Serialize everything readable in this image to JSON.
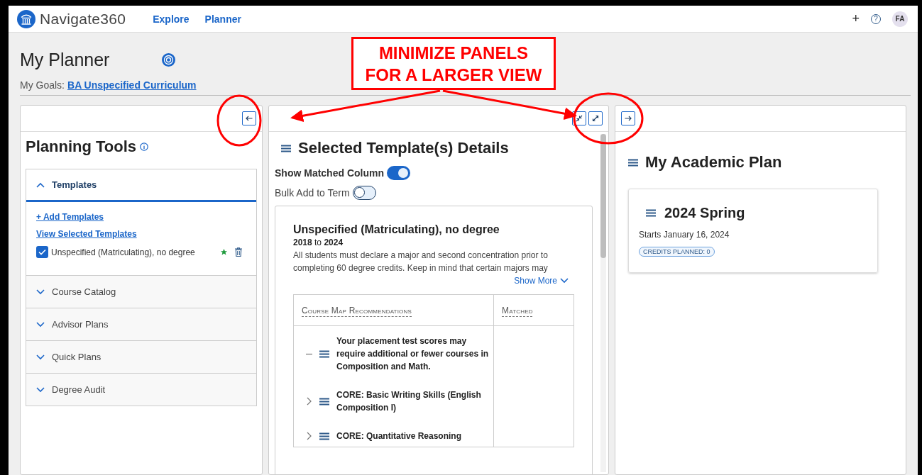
{
  "header": {
    "brand": "Navigate360",
    "nav": [
      "Explore",
      "Planner"
    ],
    "add_label": "+",
    "help_label": "?",
    "avatar": "FA"
  },
  "page": {
    "title": "My Planner",
    "goals_label": "My Goals:",
    "goals_link": "BA Unspecified Curriculum"
  },
  "callout": {
    "lines": [
      "MINIMIZE PANELS",
      "FOR A LARGER VIEW"
    ]
  },
  "planning_tools": {
    "title": "Planning Tools",
    "sections": [
      {
        "label": "Templates",
        "expanded": true,
        "links": [
          "+ Add Templates",
          "View Selected Templates"
        ],
        "templates": [
          {
            "name": "Unspecified (Matriculating), no degree",
            "checked": true
          }
        ]
      },
      {
        "label": "Course Catalog",
        "expanded": false
      },
      {
        "label": "Advisor Plans",
        "expanded": false
      },
      {
        "label": "Quick Plans",
        "expanded": false
      },
      {
        "label": "Degree Audit",
        "expanded": false
      }
    ]
  },
  "details": {
    "title": "Selected Template(s) Details",
    "toggles": [
      {
        "label": "Show Matched Column",
        "on": true
      },
      {
        "label": "Bulk Add to Term",
        "on": false
      }
    ],
    "template": {
      "name": "Unspecified (Matriculating), no degree",
      "years": "**2018** to **2024**",
      "description": "All students must declare a major and second concentration prior to completing 60 degree credits. Keep in mind that certain majors may",
      "show_more": "Show More"
    },
    "table": {
      "columns": [
        "Course Map Recommendations",
        "Matched"
      ],
      "rows": [
        {
          "text": "Your placement test scores may require additional or fewer courses in Composition and Math.",
          "expanded": true
        },
        {
          "text": "CORE: Basic Writing Skills (English Composition I)",
          "expanded": false
        },
        {
          "text": "CORE: Quantitative Reasoning",
          "expanded": false
        }
      ]
    }
  },
  "academic_plan": {
    "title": "My Academic Plan",
    "terms": [
      {
        "name": "2024 Spring",
        "starts": "Starts January 16, 2024",
        "credits": "CREDITS PLANNED: 0"
      }
    ]
  }
}
